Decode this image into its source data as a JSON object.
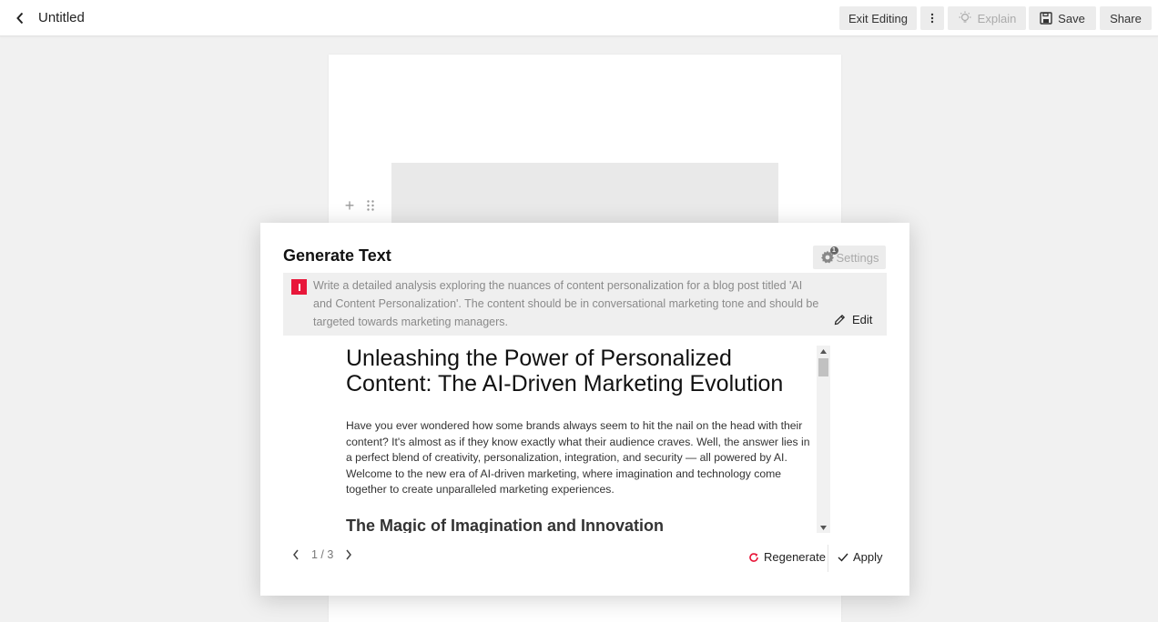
{
  "topbar": {
    "title": "Untitled",
    "exit_editing": "Exit Editing",
    "explain": "Explain",
    "save": "Save",
    "share": "Share"
  },
  "dialog": {
    "title": "Generate Text",
    "settings_label": "Settings",
    "settings_badge": "1",
    "prompt": "Write a detailed analysis exploring the nuances of content personalization for a blog post titled 'AI and Content Personalization'. The content should be in conversational marketing tone and should be targeted towards marketing managers.",
    "edit_label": "Edit",
    "content": {
      "heading": "Unleashing the Power of Personalized Content: The AI-Driven Marketing Evolution",
      "paragraph": "Have you ever wondered how some brands always seem to hit the nail on the head with their content? It's almost as if they know exactly what their audience craves. Well, the answer lies in a perfect blend of creativity, personalization, integration, and security — all powered by AI. Welcome to the new era of AI-driven marketing, where imagination and technology come together to create unparalleled marketing experiences.",
      "subheading": "The Magic of Imagination and Innovation"
    },
    "pager": "1 / 3",
    "regenerate_label": "Regenerate",
    "apply_label": "Apply"
  },
  "colors": {
    "accent": "#e8173a",
    "page_bg": "#f1f1f1",
    "button_bg": "#ececec"
  },
  "icons": {
    "back": "chevron-left-icon",
    "more": "kebab-icon",
    "explain": "lightbulb-icon",
    "save": "floppy-disk-icon",
    "settings": "gear-icon",
    "prompt": "text-cursor-icon",
    "edit": "pencil-icon",
    "regenerate": "refresh-icon",
    "apply": "checkmark-icon"
  }
}
